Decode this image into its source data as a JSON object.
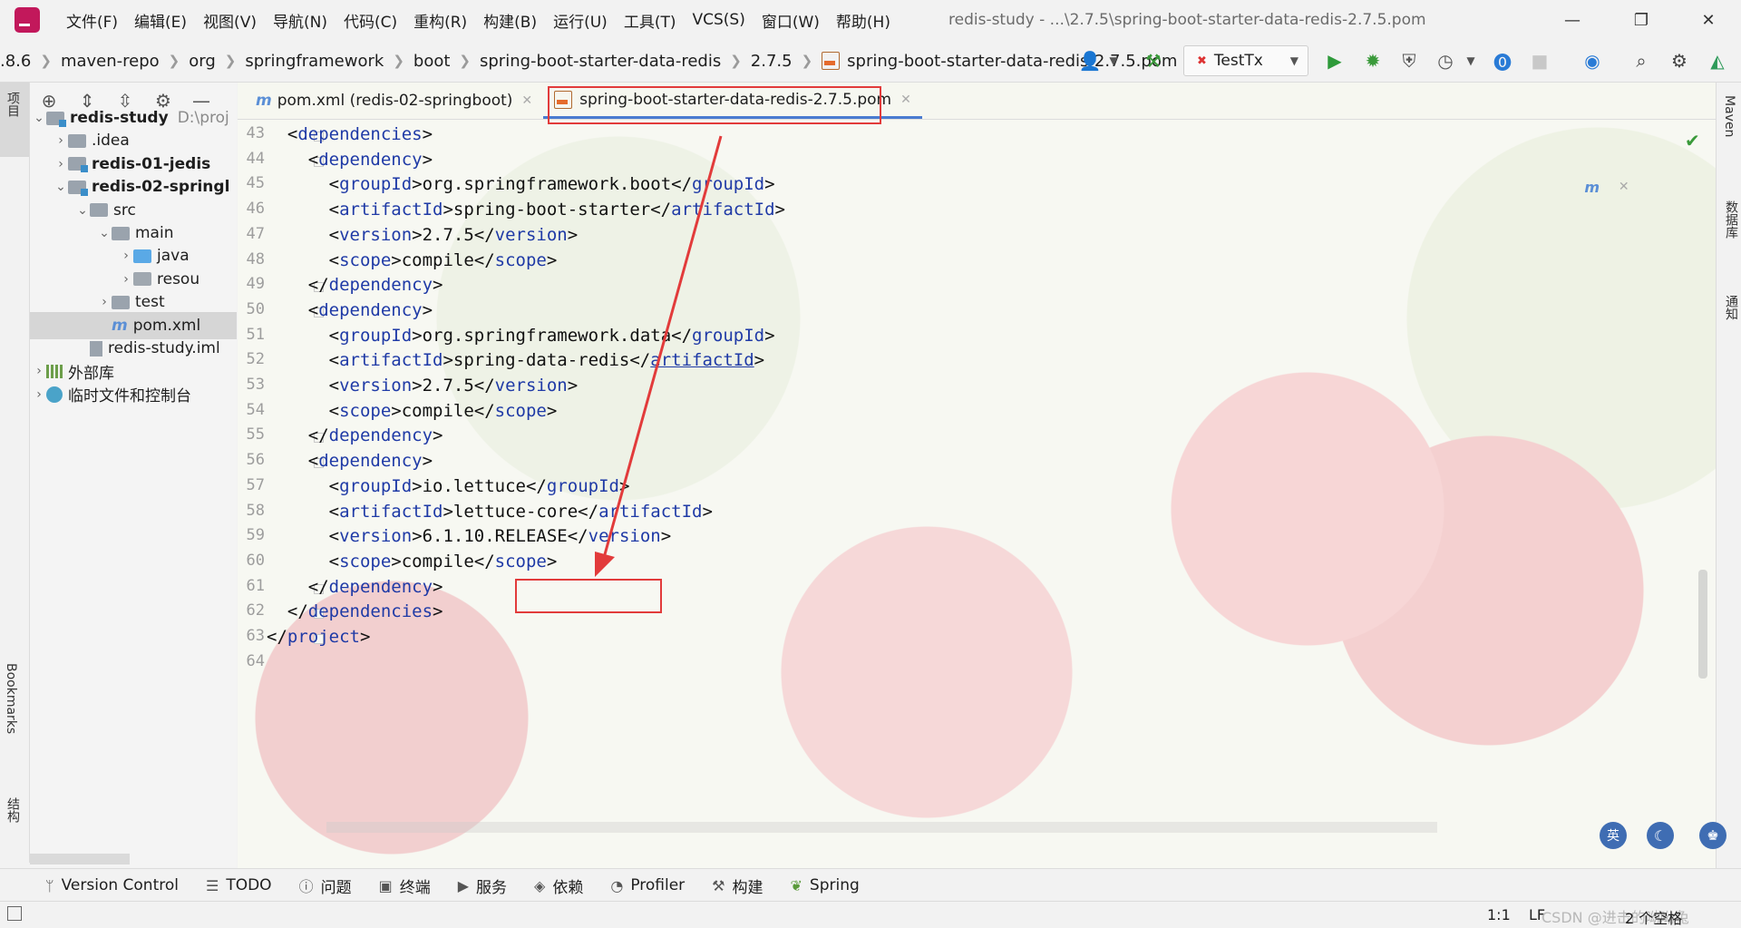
{
  "titlebar": {
    "menu": [
      "文件(F)",
      "编辑(E)",
      "视图(V)",
      "导航(N)",
      "代码(C)",
      "重构(R)",
      "构建(B)",
      "运行(U)",
      "工具(T)",
      "VCS(S)",
      "窗口(W)",
      "帮助(H)"
    ],
    "window_title": "redis-study - ...\\2.7.5\\spring-boot-starter-data-redis-2.7.5.pom",
    "minimize": "—",
    "restore": "❐",
    "close": "✕"
  },
  "navbar": {
    "breadcrumb": [
      ".8.6",
      "maven-repo",
      "org",
      "springframework",
      "boot",
      "spring-boot-starter-data-redis",
      "2.7.5"
    ],
    "breadcrumb_file": "spring-boot-starter-data-redis-2.7.5.pom",
    "run_config": "TestTx",
    "icons": [
      "user-icon",
      "build-hammer-icon",
      "run-icon",
      "debug-icon",
      "coverage-icon",
      "profile-icon",
      "help-icon",
      "stop-icon",
      "update-icon",
      "search-icon",
      "settings-icon",
      "plugin-icon"
    ]
  },
  "left_strip": {
    "project_label": "项目",
    "bookmarks_label": "Bookmarks",
    "structure_label": "结构"
  },
  "project": {
    "toolbar_icons": [
      "locate-icon",
      "expand-all-icon",
      "collapse-all-icon",
      "gear-icon",
      "minimize-icon"
    ],
    "tree": [
      {
        "label": "redis-study",
        "suffix": "D:\\proj",
        "type": "module",
        "indent": 0,
        "chevron": "open",
        "bold": true
      },
      {
        "label": ".idea",
        "type": "folder",
        "indent": 1,
        "chevron": "closed"
      },
      {
        "label": "redis-01-jedis",
        "type": "module",
        "indent": 1,
        "chevron": "closed",
        "bold": true
      },
      {
        "label": "redis-02-springl",
        "type": "module",
        "indent": 1,
        "chevron": "open",
        "bold": true
      },
      {
        "label": "src",
        "type": "folder",
        "indent": 2,
        "chevron": "open"
      },
      {
        "label": "main",
        "type": "folder",
        "indent": 3,
        "chevron": "open"
      },
      {
        "label": "java",
        "type": "java",
        "indent": 4,
        "chevron": "closed"
      },
      {
        "label": "resou",
        "type": "res",
        "indent": 4,
        "chevron": "closed"
      },
      {
        "label": "test",
        "type": "folder",
        "indent": 3,
        "chevron": "closed"
      },
      {
        "label": "pom.xml",
        "type": "maven",
        "indent": 3,
        "chevron": "none",
        "selected": true
      },
      {
        "label": "redis-study.iml",
        "type": "iml",
        "indent": 2,
        "chevron": "none"
      },
      {
        "label": "外部库",
        "type": "lib",
        "indent": 0,
        "chevron": "closed"
      },
      {
        "label": "临时文件和控制台",
        "type": "scratch",
        "indent": 0,
        "chevron": "closed"
      }
    ]
  },
  "editor": {
    "tabs": [
      {
        "label": "pom.xml (redis-02-springboot)",
        "icon": "m",
        "active": false
      },
      {
        "label": "spring-boot-starter-data-redis-2.7.5.pom",
        "icon": "pom",
        "active": true
      }
    ],
    "maven_popup_icon": "m",
    "lines": [
      {
        "n": "43",
        "t": "  <dependencies>"
      },
      {
        "n": "44",
        "t": "    <dependency>"
      },
      {
        "n": "45",
        "t": "      <groupId>org.springframework.boot</groupId>"
      },
      {
        "n": "46",
        "t": "      <artifactId>spring-boot-starter</artifactId>"
      },
      {
        "n": "47",
        "t": "      <version>2.7.5</version>"
      },
      {
        "n": "48",
        "t": "      <scope>compile</scope>"
      },
      {
        "n": "49",
        "t": "    </dependency>"
      },
      {
        "n": "50",
        "t": "    <dependency>"
      },
      {
        "n": "51",
        "t": "      <groupId>org.springframework.data</groupId>"
      },
      {
        "n": "52",
        "t": "      <artifactId>spring-data-redis</artifactId>"
      },
      {
        "n": "53",
        "t": "      <version>2.7.5</version>"
      },
      {
        "n": "54",
        "t": "      <scope>compile</scope>"
      },
      {
        "n": "55",
        "t": "    </dependency>"
      },
      {
        "n": "56",
        "t": "    <dependency>"
      },
      {
        "n": "57",
        "t": "      <groupId>io.lettuce</groupId>"
      },
      {
        "n": "58",
        "t": "      <artifactId>lettuce-core</artifactId>"
      },
      {
        "n": "59",
        "t": "      <version>6.1.10.RELEASE</version>"
      },
      {
        "n": "60",
        "t": "      <scope>compile</scope>"
      },
      {
        "n": "61",
        "t": "    </dependency>"
      },
      {
        "n": "62",
        "t": "  </dependencies>"
      },
      {
        "n": "63",
        "t": "</project>"
      },
      {
        "n": "64",
        "t": ""
      }
    ]
  },
  "right_strip": {
    "maven": "Maven",
    "database": "数据库",
    "notifications": "通知"
  },
  "bottom_tools": [
    {
      "label": "Version Control",
      "icon": "ᛘ"
    },
    {
      "label": "TODO",
      "icon": "☰"
    },
    {
      "label": "问题",
      "icon": "ⓘ"
    },
    {
      "label": "终端",
      "icon": "▣"
    },
    {
      "label": "服务",
      "icon": "▶"
    },
    {
      "label": "依赖",
      "icon": "◈"
    },
    {
      "label": "Profiler",
      "icon": "◔"
    },
    {
      "label": "构建",
      "icon": "⚒"
    },
    {
      "label": "Spring",
      "icon": "❦"
    }
  ],
  "status": {
    "position": "1:1",
    "line_sep": "LF",
    "watermark": "CSDN @进击的呦呦兔",
    "indent": "2 个空格"
  },
  "colors": {
    "highlight": "#e23b3b",
    "tag": "#1f3aa6",
    "accent": "#4a7bd0"
  }
}
